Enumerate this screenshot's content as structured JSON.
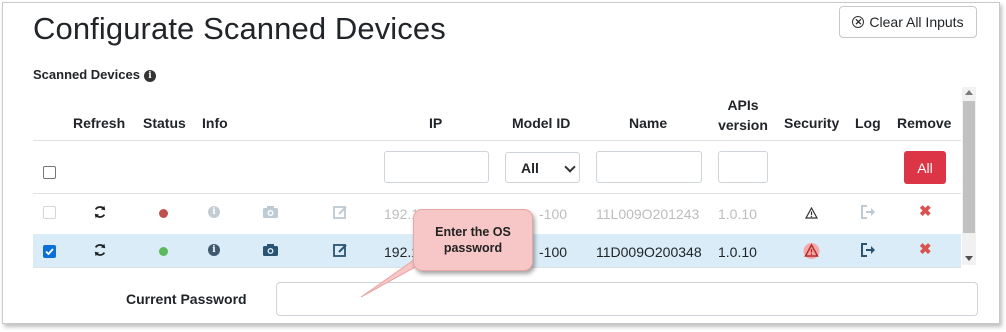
{
  "page": {
    "title": "Configurate Scanned Devices",
    "clear_button": "Clear All Inputs",
    "section_label": "Scanned Devices"
  },
  "table": {
    "headers": {
      "refresh": "Refresh",
      "status": "Status",
      "info": "Info",
      "ip": "IP",
      "model_id": "Model ID",
      "name": "Name",
      "apis_version_line1": "APIs",
      "apis_version_line2": "version",
      "security": "Security",
      "log": "Log",
      "remove": "Remove"
    },
    "filters": {
      "model_select_value": "All",
      "remove_all_button": "All"
    },
    "rows": [
      {
        "checked": false,
        "status_color": "#c0504d",
        "ip": "192.1",
        "model": "-100",
        "name": "11L009O201243",
        "apis_version": "1.0.10",
        "security_icon": "warning-outline-icon"
      },
      {
        "checked": true,
        "status_color": "#5cb85c",
        "ip": "192.1",
        "model": "-100",
        "name": "11D009O200348",
        "apis_version": "1.0.10",
        "security_icon": "warning-alert-icon"
      }
    ]
  },
  "password": {
    "label": "Current Password",
    "value": ""
  },
  "callout": {
    "line1": "Enter the OS",
    "line2": "password"
  },
  "colors": {
    "danger": "#dc3545",
    "icon_blue": "#2a5472",
    "selected_row": "#d9ecf7",
    "callout": "#f6c7c6"
  }
}
